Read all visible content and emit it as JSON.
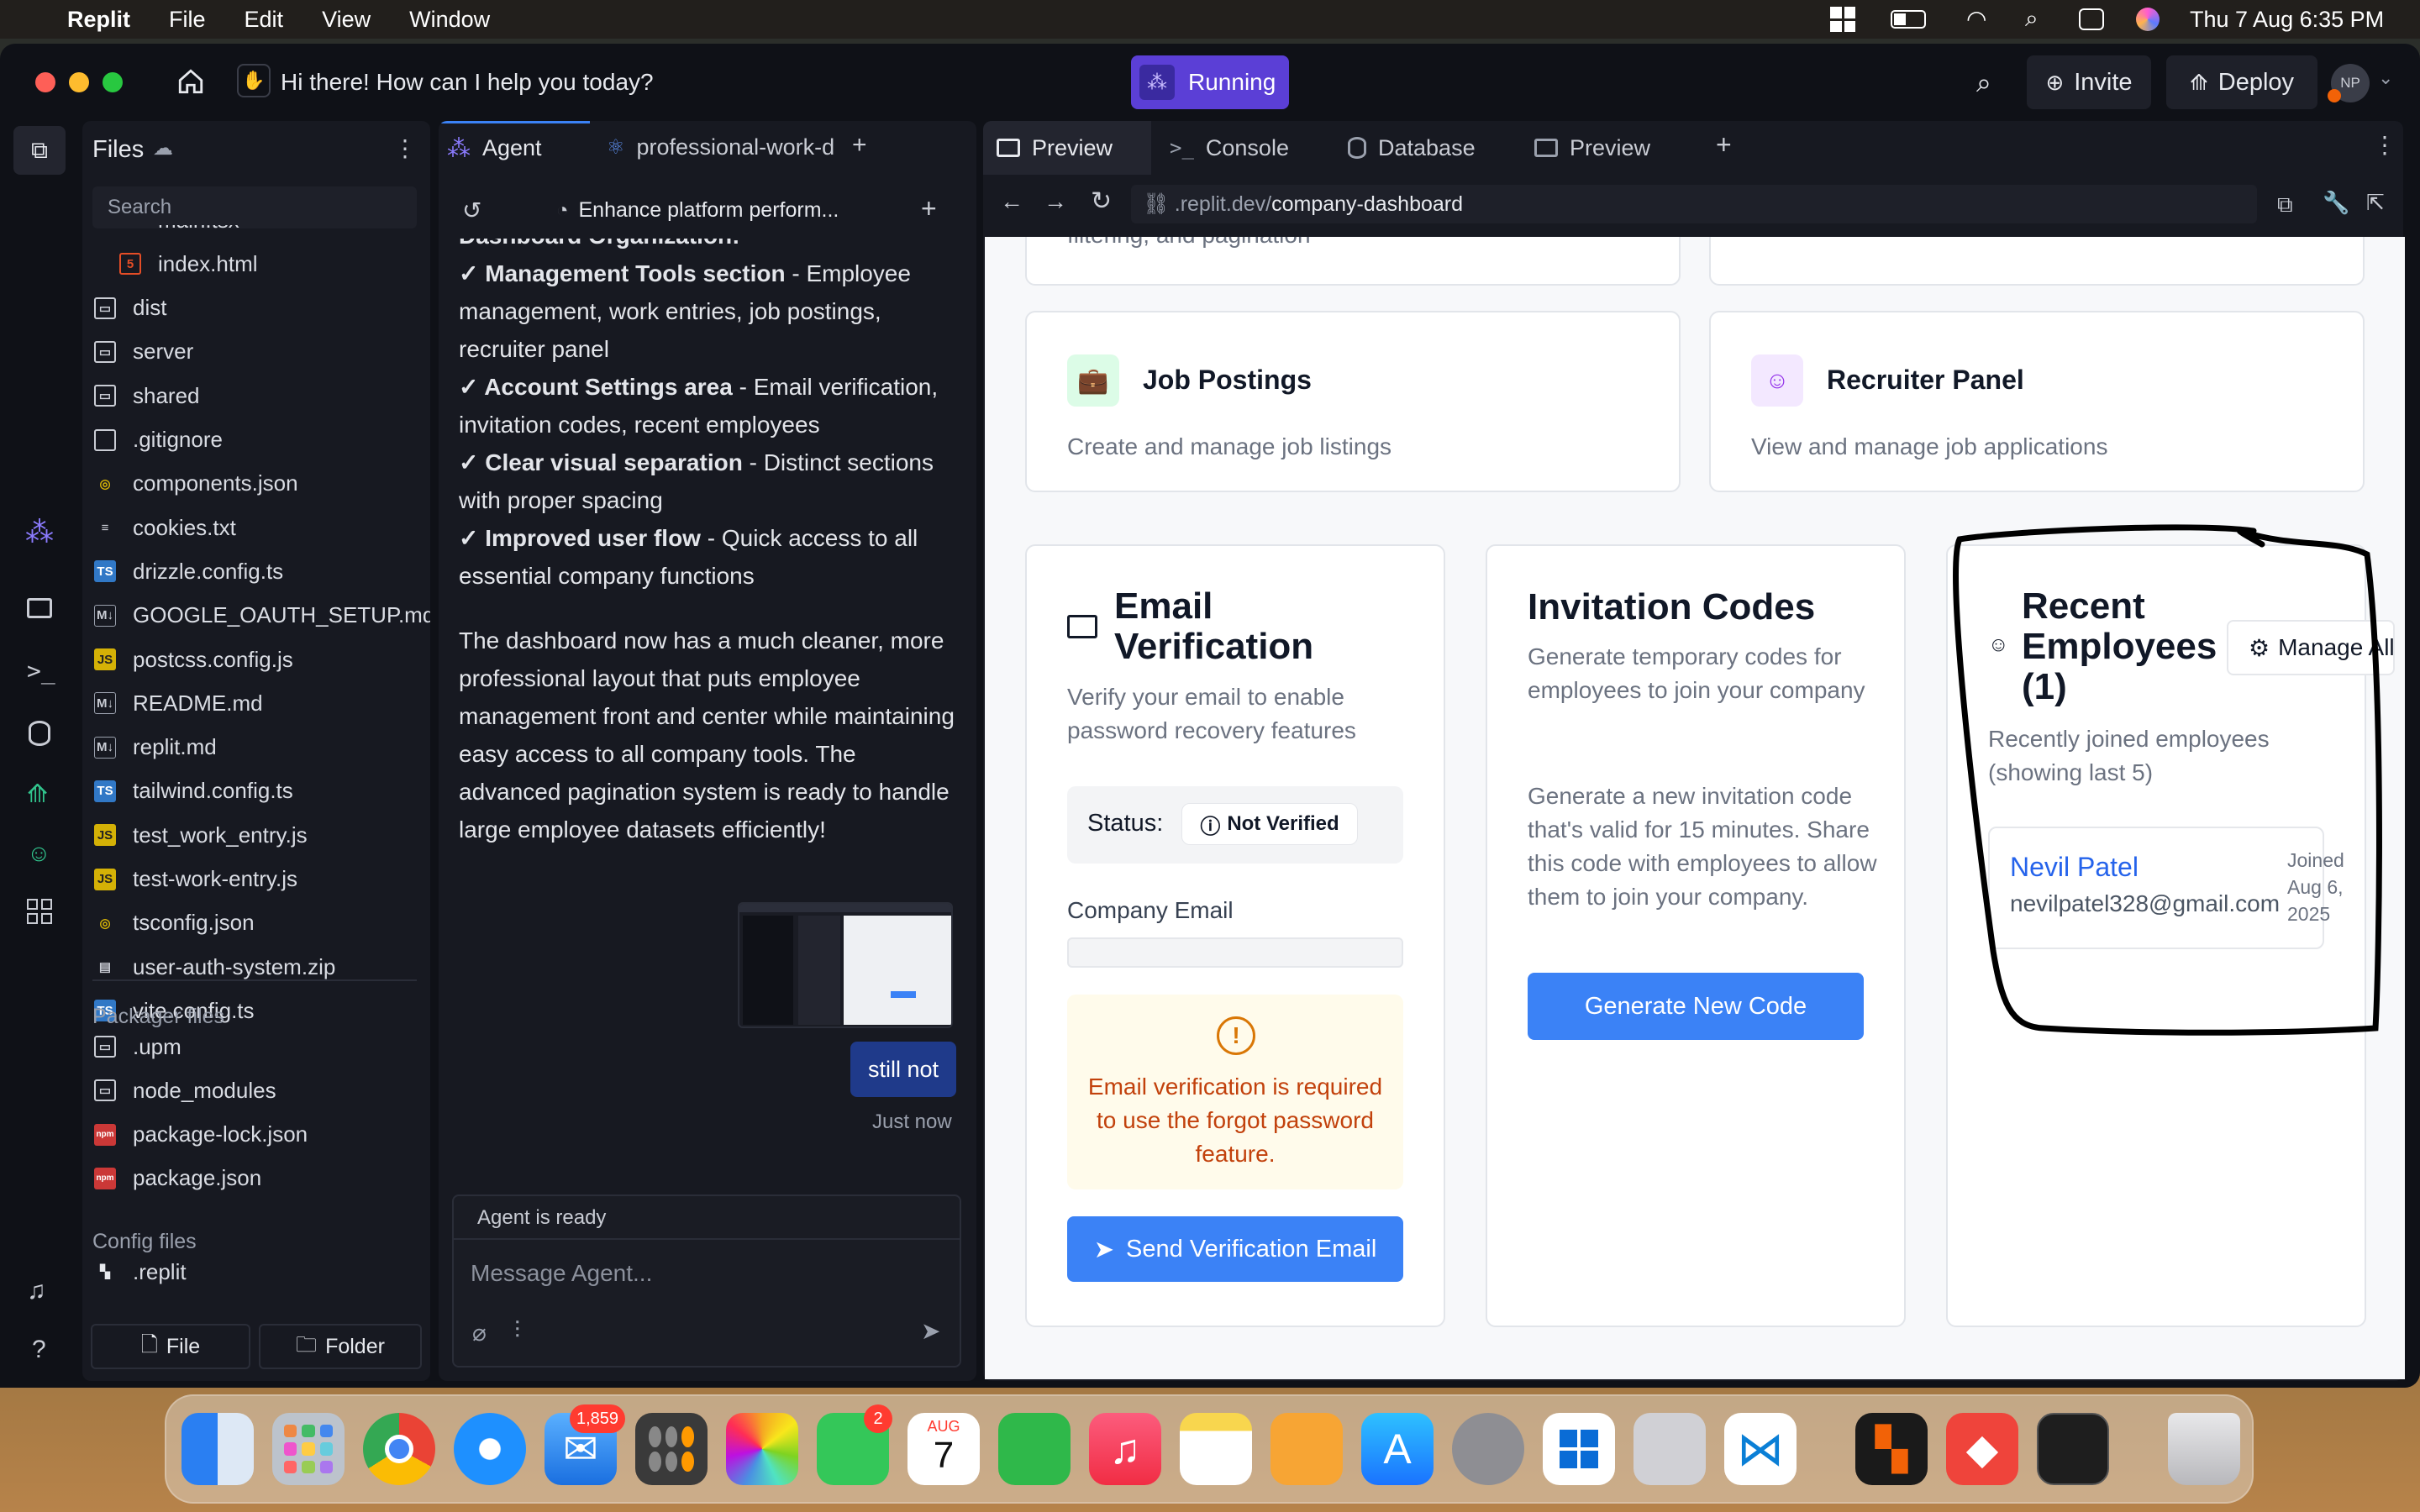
{
  "menubar": {
    "app": "Replit",
    "items": [
      "File",
      "Edit",
      "View",
      "Window"
    ],
    "clock": "Thu 7 Aug  6:35 PM"
  },
  "topbar": {
    "greeting": "Hi there! How can I help you today?",
    "status": "Running",
    "invite": "Invite",
    "deploy": "Deploy",
    "avatar": "NP"
  },
  "files": {
    "title": "Files",
    "search_placeholder": "Search",
    "items": [
      {
        "name": "main.tsx",
        "icon": "react"
      },
      {
        "name": "index.html",
        "icon": "html"
      },
      {
        "name": "dist",
        "icon": "folder"
      },
      {
        "name": "server",
        "icon": "folder"
      },
      {
        "name": "shared",
        "icon": "folder"
      },
      {
        "name": ".gitignore",
        "icon": "file"
      },
      {
        "name": "components.json",
        "icon": "json"
      },
      {
        "name": "cookies.txt",
        "icon": "txt"
      },
      {
        "name": "drizzle.config.ts",
        "icon": "ts"
      },
      {
        "name": "GOOGLE_OAUTH_SETUP.md",
        "icon": "md"
      },
      {
        "name": "postcss.config.js",
        "icon": "js"
      },
      {
        "name": "README.md",
        "icon": "md"
      },
      {
        "name": "replit.md",
        "icon": "md"
      },
      {
        "name": "tailwind.config.ts",
        "icon": "ts"
      },
      {
        "name": "test_work_entry.js",
        "icon": "js"
      },
      {
        "name": "test-work-entry.js",
        "icon": "js"
      },
      {
        "name": "tsconfig.json",
        "icon": "json"
      },
      {
        "name": "user-auth-system.zip",
        "icon": "zip"
      },
      {
        "name": "vite.config.ts",
        "icon": "ts"
      }
    ],
    "packager_title": "Packager files",
    "packager_items": [
      {
        "name": ".upm",
        "icon": "folder"
      },
      {
        "name": "node_modules",
        "icon": "folder"
      },
      {
        "name": "package-lock.json",
        "icon": "npm"
      },
      {
        "name": "package.json",
        "icon": "npm"
      }
    ],
    "config_title": "Config files",
    "config_items": [
      {
        "name": ".replit",
        "icon": "replit"
      }
    ],
    "new_file": "File",
    "new_folder": "Folder"
  },
  "agent": {
    "tab_agent": "Agent",
    "tab_file": "professional-work-d",
    "thread_title": "Enhance platform perform...",
    "cut_heading": "Dashboard Organization:",
    "bullets": [
      {
        "bold": "✓ Management Tools section",
        "rest": " - Employee management, work entries, job postings, recruiter panel"
      },
      {
        "bold": "✓ Account Settings area",
        "rest": " - Email verification, invitation codes, recent employees"
      },
      {
        "bold": "✓ Clear visual separation",
        "rest": " - Distinct sections with proper spacing"
      },
      {
        "bold": "✓ Improved user flow",
        "rest": " - Quick access to all essential company functions"
      }
    ],
    "summary": "The dashboard now has a much cleaner, more professional layout that puts employee management front and center while maintaining easy access to all company tools. The advanced pagination system is ready to handle large employee datasets efficiently!",
    "user_message": "still not",
    "timestamp": "Just now",
    "status": "Agent is ready",
    "input_placeholder": "Message Agent..."
  },
  "preview": {
    "tabs": [
      "Preview",
      "Console",
      "Database",
      "Preview"
    ],
    "url_prefix": ".replit.dev/",
    "url_path": "company-dashboard",
    "cut_text": "filtering, and pagination",
    "job_postings": {
      "title": "Job Postings",
      "desc": "Create and manage job listings"
    },
    "recruiter_panel": {
      "title": "Recruiter Panel",
      "desc": "View and manage job applications"
    },
    "email": {
      "title": "Email Verification",
      "desc": "Verify your email to enable password recovery features",
      "status_label": "Status:",
      "status_value": "Not Verified",
      "company_email_label": "Company Email",
      "warning": "Email verification is required to use the forgot password feature.",
      "button": "Send Verification Email"
    },
    "invitation": {
      "title": "Invitation Codes",
      "desc": "Generate temporary codes for employees to join your company",
      "body": "Generate a new invitation code that's valid for 15 minutes. Share this code with employees to allow them to join your company.",
      "button": "Generate New Code"
    },
    "recent": {
      "title": "Recent Employees (1)",
      "manage": "Manage All",
      "desc": "Recently joined employees (showing last 5)",
      "employee_name": "Nevil Patel",
      "employee_email": "nevilpatel328@gmail.com",
      "joined": "Joined Aug 6, 2025"
    }
  },
  "dock": {
    "mail_badge": "1,859",
    "facetime_badge": "2",
    "cal_month": "AUG",
    "cal_day": "7"
  },
  "colors": {
    "accent": "#3b82f6",
    "running": "#5b3fd6",
    "brand": "#f26207"
  }
}
